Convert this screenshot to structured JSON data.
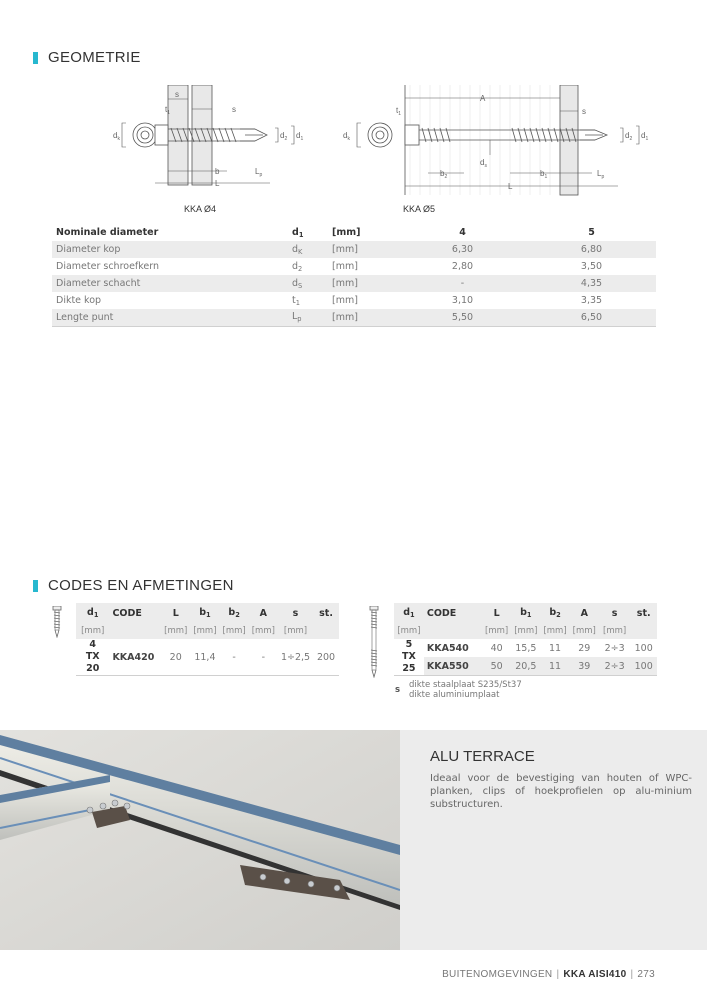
{
  "geometry": {
    "section_title": "GEOMETRIE",
    "figures": [
      {
        "label": "KKA Ø4",
        "annotations": [
          "s",
          "t1",
          "s",
          "dK",
          "d2",
          "d1",
          "b",
          "Lp",
          "L"
        ]
      },
      {
        "label": "KKA Ø5",
        "annotations": [
          "A",
          "t1",
          "s",
          "dK",
          "d2",
          "d1",
          "dS",
          "b2",
          "b1",
          "Lp",
          "L"
        ]
      }
    ],
    "table": {
      "header": {
        "name": "Nominale diameter",
        "symbol": "d",
        "symbol_sub": "1",
        "unit": "[mm]",
        "values": [
          "4",
          "5"
        ]
      },
      "rows": [
        {
          "name": "Diameter kop",
          "symbol": "d",
          "symbol_sub": "K",
          "unit": "[mm]",
          "values": [
            "6,30",
            "6,80"
          ]
        },
        {
          "name": "Diameter schroefkern",
          "symbol": "d",
          "symbol_sub": "2",
          "unit": "[mm]",
          "values": [
            "2,80",
            "3,50"
          ]
        },
        {
          "name": "Diameter schacht",
          "symbol": "d",
          "symbol_sub": "S",
          "unit": "[mm]",
          "values": [
            "-",
            "4,35"
          ]
        },
        {
          "name": "Dikte kop",
          "symbol": "t",
          "symbol_sub": "1",
          "unit": "[mm]",
          "values": [
            "3,10",
            "3,35"
          ]
        },
        {
          "name": "Lengte punt",
          "symbol": "L",
          "symbol_sub": "p",
          "unit": "[mm]",
          "values": [
            "5,50",
            "6,50"
          ]
        }
      ]
    }
  },
  "codes": {
    "section_title": "CODES EN AFMETINGEN",
    "columns": [
      {
        "label": "d",
        "sub": "1",
        "unit": "[mm]"
      },
      {
        "label": "CODE",
        "sub": "",
        "unit": ""
      },
      {
        "label": "L",
        "sub": "",
        "unit": "[mm]"
      },
      {
        "label": "b",
        "sub": "1",
        "unit": "[mm]"
      },
      {
        "label": "b",
        "sub": "2",
        "unit": "[mm]"
      },
      {
        "label": "A",
        "sub": "",
        "unit": "[mm]"
      },
      {
        "label": "s",
        "sub": "",
        "unit": "[mm]"
      },
      {
        "label": "st.",
        "sub": "",
        "unit": ""
      }
    ],
    "table_left": {
      "d1": "4",
      "drive": "TX 20",
      "rows": [
        {
          "code": "KKA420",
          "L": "20",
          "b1": "11,4",
          "b2": "-",
          "A": "-",
          "s": "1÷2,5",
          "st": "200"
        }
      ]
    },
    "table_right": {
      "d1": "5",
      "drive": "TX 25",
      "rows": [
        {
          "code": "KKA540",
          "L": "40",
          "b1": "15,5",
          "b2": "11",
          "A": "29",
          "s": "2÷3",
          "st": "100"
        },
        {
          "code": "KKA550",
          "L": "50",
          "b1": "20,5",
          "b2": "11",
          "A": "39",
          "s": "2÷3",
          "st": "100"
        }
      ]
    },
    "note": {
      "symbol": "s",
      "lines": [
        "dikte staalplaat S235/St37",
        "dikte aluminiumplaat"
      ]
    }
  },
  "application": {
    "title": "ALU TERRACE",
    "description": "Ideaal voor de bevestiging van houten of WPC-planken, clips of hoekprofielen op alu-minium substructuren.",
    "image_alt": "aluminium-terrace-substructure-photo"
  },
  "footer": {
    "section": "BUITENOMGEVINGEN",
    "product": "KKA AISI410",
    "page": "273"
  },
  "colors": {
    "accent": "#27b8cf",
    "row_shade": "#ececec",
    "heading_text": "#333333",
    "body_text": "#777777"
  }
}
